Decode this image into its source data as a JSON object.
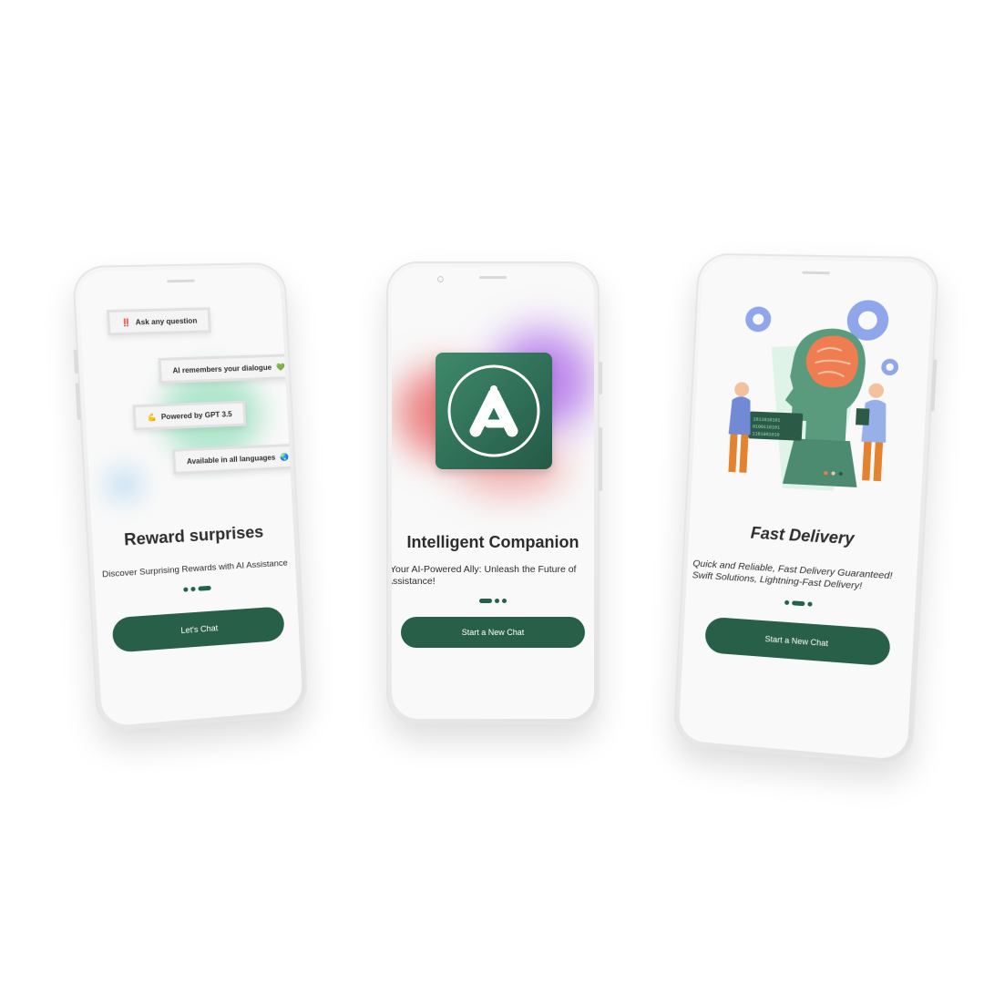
{
  "colors": {
    "accent": "#285f49",
    "text": "#2d2d2d",
    "background": "#ffffff"
  },
  "left_phone": {
    "chips": [
      {
        "icon": "double-exclamation-icon",
        "glyph": "‼️",
        "label": "Ask any question"
      },
      {
        "icon": "green-heart-icon",
        "glyph": "💚",
        "label": "AI remembers your dialogue"
      },
      {
        "icon": "flexed-biceps-icon",
        "glyph": "💪",
        "label": "Powered by GPT 3.5"
      },
      {
        "icon": "globe-icon",
        "glyph": "🌏",
        "label": "Available in all languages"
      }
    ],
    "title": "Reward surprises",
    "subtitle": "Discover Surprising Rewards with AI Assistance",
    "page_indicator": {
      "count": 3,
      "active": 3
    },
    "button_label": "Let's Chat"
  },
  "middle_phone": {
    "logo_icon": "ai-logo-icon",
    "title": "Intelligent Companion",
    "subtitle_line1": "Your AI-Powered Ally: Unleash the Future of",
    "subtitle_line2": "Assistance!",
    "page_indicator": {
      "count": 3,
      "active": 1
    },
    "button_label": "Start a New Chat"
  },
  "right_phone": {
    "illustration_icon": "ai-brain-illustration-icon",
    "title": "Fast Delivery",
    "subtitle_line1": "Quick and Reliable, Fast Delivery Guaranteed!",
    "subtitle_line2": "Swift Solutions, Lightning-Fast Delivery!",
    "page_indicator": {
      "count": 3,
      "active": 2
    },
    "button_label": "Start a New Chat"
  }
}
